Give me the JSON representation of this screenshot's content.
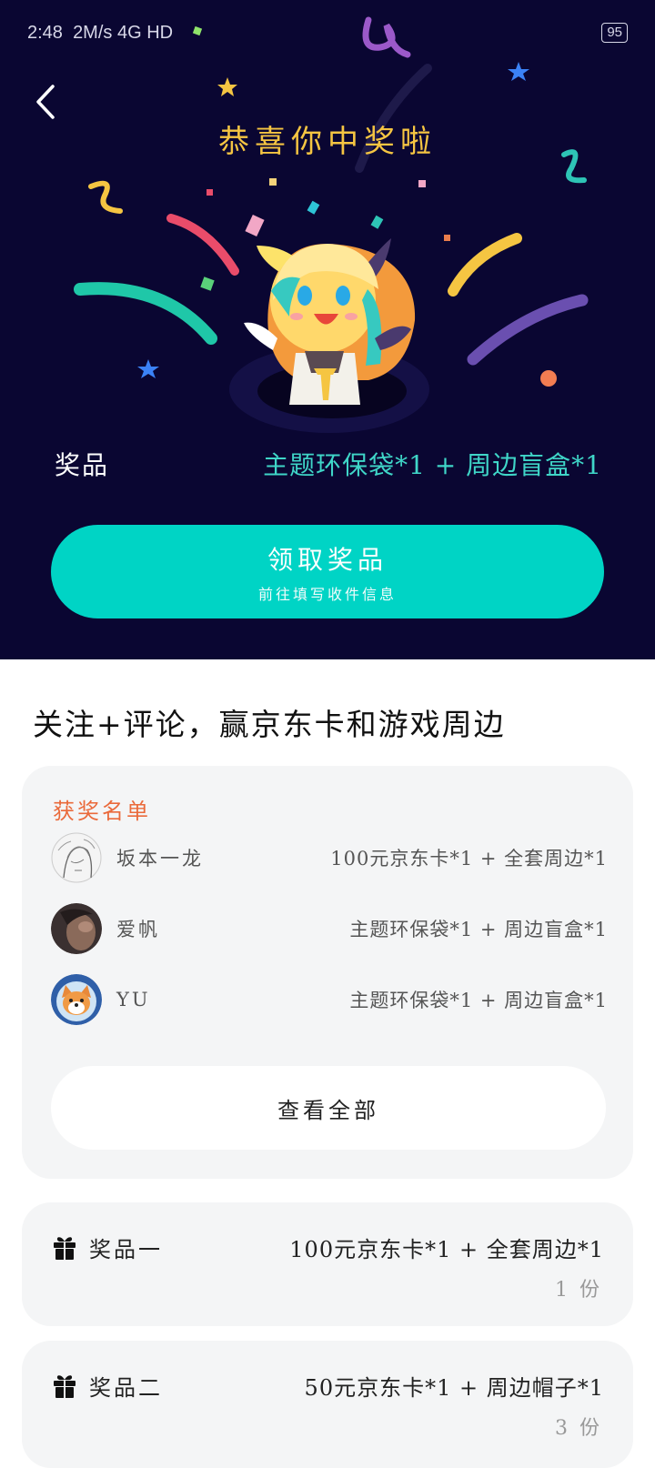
{
  "status": {
    "time": "2:48",
    "network": "2M/s 4G HD",
    "battery": "95"
  },
  "hero": {
    "title": "恭喜你中奖啦",
    "prize_label": "奖品",
    "prize_value": "主题环保袋*1 + 周边盲盒*1",
    "claim_button": "领取奖品",
    "claim_sub": "前往填写收件信息"
  },
  "section_title": "关注+评论，赢京东卡和游戏周边",
  "winners": {
    "title": "获奖名单",
    "items": [
      {
        "name": "坂本一龙",
        "prize": "100元京东卡*1 + 全套周边*1"
      },
      {
        "name": "爱帆",
        "prize": "主题环保袋*1 + 周边盲盒*1"
      },
      {
        "name": "YU",
        "prize": "主题环保袋*1 + 周边盲盒*1"
      }
    ],
    "see_all": "查看全部"
  },
  "tiers": [
    {
      "label": "奖品一",
      "prize": "100元京东卡*1 + 全套周边*1",
      "count": "1 份"
    },
    {
      "label": "奖品二",
      "prize": "50元京东卡*1 + 周边帽子*1",
      "count": "3 份"
    }
  ],
  "colors": {
    "hero_bg": "#0a0632",
    "accent": "#00d4c5",
    "title_gold": "#f5c542",
    "winners_title": "#ea6a3b"
  }
}
